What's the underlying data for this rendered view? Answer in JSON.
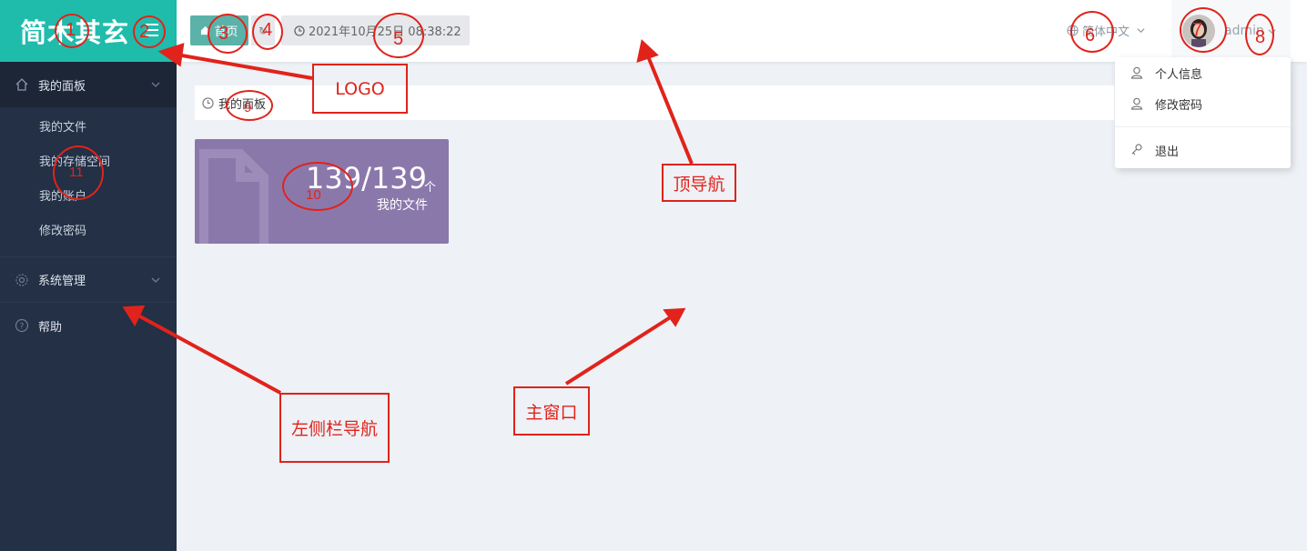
{
  "logo": {
    "text": "简木其玄"
  },
  "sidebar": {
    "panel_label": "我的面板",
    "panel_items": [
      "我的文件",
      "我的存储空间",
      "我的账户",
      "修改密码"
    ],
    "system_label": "系统管理",
    "help_label": "帮助"
  },
  "topbar": {
    "home_label": "首页",
    "datetime": "2021年10月25日 08:38:22",
    "language": "简体中文",
    "username": "admin"
  },
  "dropdown": {
    "profile": "个人信息",
    "password": "修改密码",
    "logout": "退出"
  },
  "main": {
    "breadcrumb": "我的面板",
    "card": {
      "value": "139/139",
      "unit": "个",
      "label": "我的文件",
      "color": "#8b78ab"
    }
  },
  "annotations": {
    "numbers": [
      "1",
      "2",
      "3",
      "4",
      "5",
      "6",
      "7",
      "8",
      "9",
      "10",
      "11"
    ],
    "boxes": {
      "logo": "LOGO",
      "top_nav": "顶导航",
      "main_window": "主窗口",
      "left_nav": "左侧栏导航"
    },
    "color": "#e0231b"
  },
  "colors": {
    "logo_bg": "#1fbcac",
    "sidebar_bg": "#233045",
    "home_btn": "#5bb2a9",
    "page_bg": "#eef1f6"
  }
}
